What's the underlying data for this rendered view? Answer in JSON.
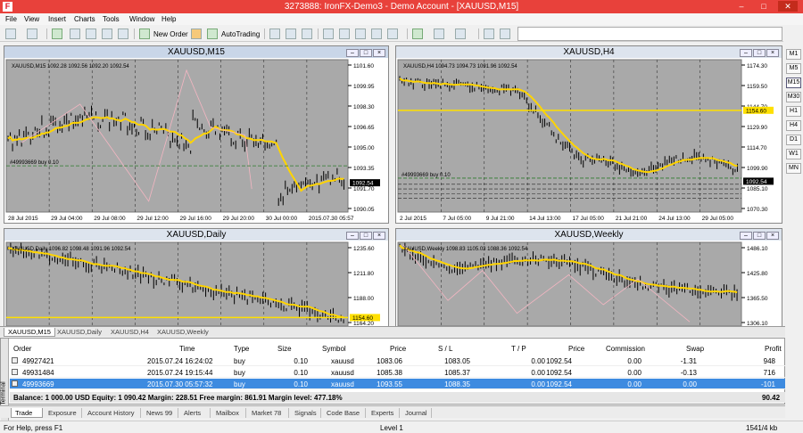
{
  "window": {
    "title": "3273888: IronFX-Demo3 - Demo Account - [XAUUSD,M15]",
    "app_icon": "F"
  },
  "menu": [
    "File",
    "View",
    "Insert",
    "Charts",
    "Tools",
    "Window",
    "Help"
  ],
  "toolbar": {
    "new_order": "New Order",
    "autotrading": "AutoTrading"
  },
  "timeframes": [
    "M1",
    "M5",
    "M15",
    "M30",
    "H1",
    "H4",
    "D1",
    "W1",
    "MN"
  ],
  "selected_timeframe": "M15",
  "charts": [
    {
      "title": "XAUUSD,M15",
      "info": "XAUUSD,M15  1092.28 1092.56 1092.20 1092.54",
      "order_label": "#49993669 buy 0.10",
      "y_labels": [
        "1101.60",
        "1099.95",
        "1098.30",
        "1096.65",
        "1095.00",
        "1093.35",
        "1091.70",
        "1090.05"
      ],
      "price_tag": "1092.54",
      "x_labels": [
        "28 Jul 2015",
        "29 Jul 04:00",
        "29 Jul 08:00",
        "29 Jul 12:00",
        "29 Jul 16:00",
        "29 Jul 20:00",
        "30 Jul 00:00",
        "2015.07.30 05:57"
      ]
    },
    {
      "title": "XAUUSD,H4",
      "info": "XAUUSD,H4  1094.73 1094.73 1091.96 1092.54",
      "order_label": "#49993669 buy 0.10",
      "y_labels": [
        "1174.30",
        "1159.50",
        "1144.70",
        "1129.90",
        "1114.70",
        "1099.90",
        "1085.10",
        "1070.30"
      ],
      "price_tag": "1092.54",
      "line_tag": "1154.60",
      "x_labels": [
        "2 Jul 2015",
        "7 Jul 05:00",
        "9 Jul 21:00",
        "14 Jul 13:00",
        "17 Jul 05:00",
        "21 Jul 21:00",
        "24 Jul 13:00",
        "29 Jul 05:00"
      ]
    },
    {
      "title": "XAUUSD,Daily",
      "info": "XAUUSD,Daily  1096.82 1098.48 1091.96 1092.54",
      "y_labels": [
        "1235.60",
        "1211.80",
        "1188.00",
        "1164.20"
      ],
      "line_tag": "1154.60"
    },
    {
      "title": "XAUUSD,Weekly",
      "info": "XAUUSD,Weekly  1098.83 1105.03 1088.36 1092.54",
      "y_labels": [
        "1486.10",
        "1425.80",
        "1365.50",
        "1306.10"
      ]
    }
  ],
  "chart_tabs": [
    "XAUUSD,M15",
    "XAUUSD,Daily",
    "XAUUSD,H4",
    "XAUUSD,Weekly"
  ],
  "table": {
    "headers": [
      "Order",
      "Time",
      "Type",
      "Size",
      "Symbol",
      "Price",
      "S / L",
      "T / P",
      "Price",
      "Commission",
      "Swap",
      "Profit"
    ],
    "rows": [
      [
        "49927421",
        "2015.07.24 16:24:02",
        "buy",
        "0.10",
        "xauusd",
        "1083.06",
        "1083.05",
        "0.00",
        "1092.54",
        "0.00",
        "-1.31",
        "948"
      ],
      [
        "49931484",
        "2015.07.24 19:15:44",
        "buy",
        "0.10",
        "xauusd",
        "1085.38",
        "1085.37",
        "0.00",
        "1092.54",
        "0.00",
        "-0.13",
        "716"
      ],
      [
        "49993669",
        "2015.07.30 05:57:32",
        "buy",
        "0.10",
        "xauusd",
        "1093.55",
        "1088.35",
        "0.00",
        "1092.54",
        "0.00",
        "0.00",
        "-101"
      ]
    ],
    "balance": "Balance: 1 000.00 USD  Equity: 1 090.42  Margin: 228.51  Free margin: 861.91  Margin level: 477.18%",
    "total": "90.42"
  },
  "terminal_label": "Terminal",
  "terminal_tabs": [
    "Trade",
    "Exposure",
    "Account History",
    "News 99",
    "Alerts",
    "Mailbox",
    "Market 78",
    "Signals",
    "Code Base",
    "Experts",
    "Journal"
  ],
  "status": {
    "help": "For Help, press F1",
    "level": "Level 1",
    "traffic": "1541/4 kb"
  },
  "colors": {
    "title_red": "#e8413b",
    "chart_bg": "#a9a9a9",
    "ma_yellow": "#ffd400",
    "selected_row": "#3d8be0"
  }
}
